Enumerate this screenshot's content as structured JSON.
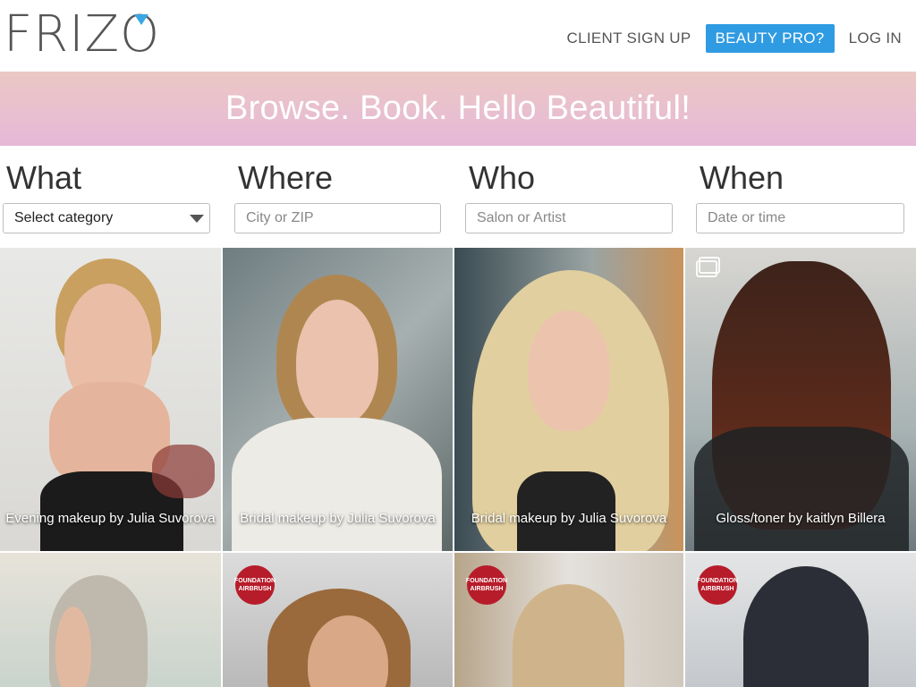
{
  "brand": {
    "name": "FRIZO"
  },
  "nav": {
    "client_signup": "CLIENT SIGN UP",
    "beauty_pro": "BEAUTY PRO?",
    "login": "LOG IN"
  },
  "banner": {
    "tagline": "Browse. Book. Hello Beautiful!"
  },
  "search": {
    "what": {
      "label": "What",
      "value": "Select category"
    },
    "where": {
      "label": "Where",
      "placeholder": "City or ZIP"
    },
    "who": {
      "label": "Who",
      "placeholder": "Salon or Artist"
    },
    "when": {
      "label": "When",
      "placeholder": "Date or time"
    }
  },
  "tiles": [
    {
      "caption": "Evening makeup by Julia Suvorova"
    },
    {
      "caption": "Bridal makeup by Julia Suvorova"
    },
    {
      "caption": "Bridal makeup by Julia Suvorova"
    },
    {
      "caption": "Gloss/toner by kaitlyn Billera"
    }
  ],
  "badges": {
    "text": "FOUNDATION AIRBRUSH"
  },
  "colors": {
    "accent": "#2f9be2",
    "banner_top": "#ebc8c4",
    "banner_bottom": "#e6b8d8",
    "badge": "#b71c2a"
  },
  "icons": {
    "gallery": "gallery-icon",
    "dropdown": "chevron-down-icon"
  }
}
